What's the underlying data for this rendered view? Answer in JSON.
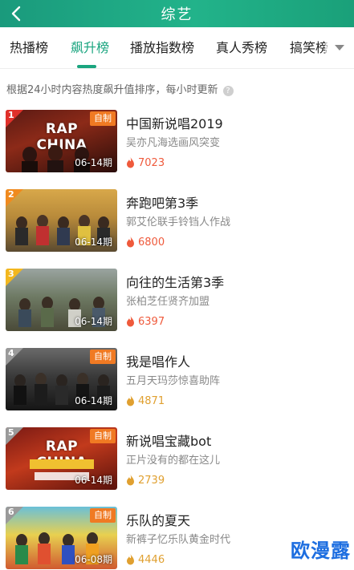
{
  "header": {
    "title": "综艺",
    "back_icon": "chevron-left-icon"
  },
  "tabs": [
    {
      "label": "热播榜",
      "active": false
    },
    {
      "label": "飙升榜",
      "active": true
    },
    {
      "label": "播放指数榜",
      "active": false
    },
    {
      "label": "真人秀榜",
      "active": false
    },
    {
      "label": "搞笑榜",
      "active": false
    }
  ],
  "tabs_more_icon": "caret-down-icon",
  "notice": {
    "text": "根据24小时内容热度飙升值排序，每小时更新",
    "icon": "question-icon"
  },
  "items": [
    {
      "rank": "1",
      "badge": "自制",
      "episode": "06-14期",
      "cover_text": "RAP CHINA",
      "title": "中国新说唱2019",
      "subtitle": "吴亦凡海选画风突变",
      "heat": "7023"
    },
    {
      "rank": "2",
      "badge": "",
      "episode": "06-14期",
      "cover_text": "",
      "title": "奔跑吧第3季",
      "subtitle": "郭艾伦联手铃铛人作战",
      "heat": "6800"
    },
    {
      "rank": "3",
      "badge": "",
      "episode": "06-14期",
      "cover_text": "",
      "title": "向往的生活第3季",
      "subtitle": "张柏芝任贤齐加盟",
      "heat": "6397"
    },
    {
      "rank": "4",
      "badge": "自制",
      "episode": "06-14期",
      "cover_text": "",
      "title": "我是唱作人",
      "subtitle": "五月天玛莎惊喜助阵",
      "heat": "4871"
    },
    {
      "rank": "5",
      "badge": "自制",
      "episode": "06-14期",
      "cover_text": "RAP CHINA",
      "title": "新说唱宝藏bot",
      "subtitle": "正片没有的都在这儿",
      "heat": "2739"
    },
    {
      "rank": "6",
      "badge": "自制",
      "episode": "06-08期",
      "cover_text": "",
      "title": "乐队的夏天",
      "subtitle": "新裤子忆乐队黄金时代",
      "heat": "4446"
    }
  ],
  "colors": {
    "accent": "#1aa57f",
    "badge": "#f07a23",
    "rank_red": "#e0302a",
    "rank_orange": "#f08a1e",
    "rank_yellow": "#f3b71e",
    "rank_gray": "#9a9a9a",
    "heat_high": "#ef5a3c",
    "heat_low": "#e0a030"
  },
  "watermark": "欧漫露"
}
